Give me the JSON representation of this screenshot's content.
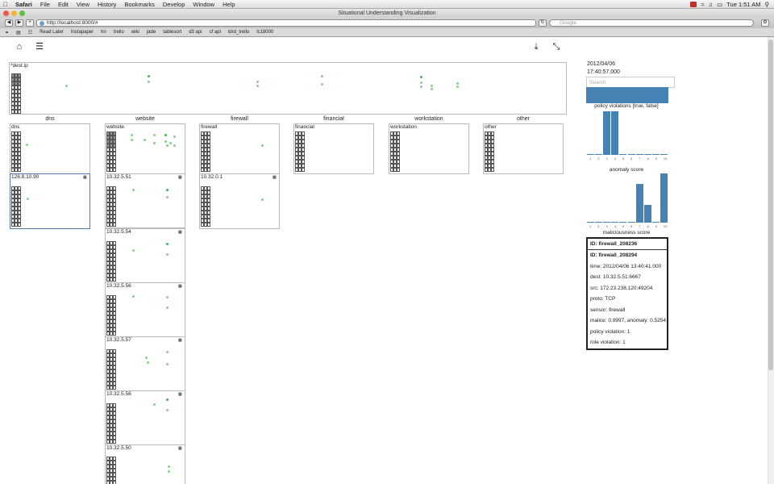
{
  "menubar": {
    "app": "Safari",
    "items": [
      "File",
      "Edit",
      "View",
      "History",
      "Bookmarks",
      "Develop",
      "Window",
      "Help"
    ],
    "clock": "Tue 1:51 AM"
  },
  "window": {
    "title": "Situational Understanding Visualization",
    "url": "http://localhost:8000/#",
    "search_placeholder": "Google"
  },
  "bookmarks": [
    "Read Later",
    "Instapaper",
    "hn",
    "trello",
    "wiki",
    "jade",
    "tablesort",
    "d3 api",
    "cf api",
    "ldrd_trello",
    "lc18000"
  ],
  "top_panel": {
    "title": "*dest.ip"
  },
  "columns": [
    "dns",
    "website",
    "firewall",
    "financial",
    "workstation",
    "other"
  ],
  "panels": {
    "dns": "dns",
    "website": "website",
    "firewall": "firewall",
    "financial": "financial",
    "workstation": "workstation",
    "other": "other",
    "dns_sub": "128.8.10.90",
    "firewall_sub": "10.32.0.1",
    "website_subs": [
      "10.32.5.51",
      "10.32.5.54",
      "10.32.5.56",
      "10.32.5.57",
      "10.32.5.58",
      "10.32.5.50"
    ]
  },
  "sidebar": {
    "search_placeholder": "Search",
    "date": "2012/04/06",
    "time": "17:40:57.000",
    "hist_policy": {
      "label": "policy violations [true, false]",
      "values": [
        1.0
      ]
    },
    "hist_anomaly": {
      "label": "anomaly score",
      "ticks": [
        "1",
        "2",
        "3",
        "4",
        "5",
        "6",
        "7",
        "8",
        "9",
        "10"
      ],
      "values": [
        0,
        0,
        1.0,
        1.0,
        0,
        0,
        0,
        0,
        0,
        0
      ]
    },
    "hist_malic": {
      "label": "maliciousness score",
      "ticks": [
        "1",
        "2",
        "3",
        "4",
        "5",
        "6",
        "7",
        "8",
        "9",
        "10"
      ],
      "values": [
        0.02,
        0,
        0,
        0,
        0,
        0.02,
        0.78,
        0.36,
        0.02,
        0.98
      ]
    },
    "details": {
      "header": "ID: firewall_208236",
      "id": "ID: firewall_208294",
      "time": "time: 2012/04/06 13:40:41.000",
      "dest": "dest: 10.32.5.51:6667",
      "src": "src: 172.23.238.120:49204",
      "proto": "proto: TCP",
      "sensor": "sensor: firewall",
      "malice": "malice: 0.9997, anomaly: 0.5254",
      "policy": "policy violation: 1",
      "role": "role violation: 1"
    }
  },
  "colors": {
    "bar": "#4682b4",
    "dot_light": "#8bd08b",
    "dot_dark": "#4caf50"
  }
}
